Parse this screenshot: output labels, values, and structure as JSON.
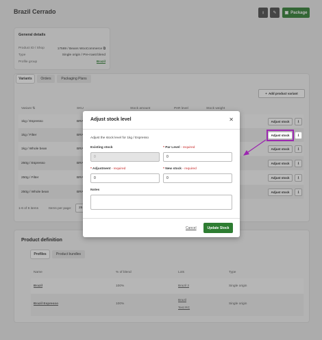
{
  "page": {
    "title": "Brazil Cerrado",
    "package_label": "Package"
  },
  "general": {
    "title": "General details",
    "rows": [
      {
        "label": "Product ID / Shop",
        "value": "17569 / Beans WooCommerce"
      },
      {
        "label": "Type",
        "value": "Single origin / Pre-roast blend"
      },
      {
        "label": "Profile group",
        "value": "Brazil"
      }
    ]
  },
  "tabs": [
    "Variants",
    "Orders",
    "Packaging Plans"
  ],
  "variants": {
    "add_label": "Add product variant",
    "headers": [
      "Variant",
      "SKU",
      "Stock amount",
      "PAR level",
      "Stock weight"
    ],
    "rows": [
      {
        "name": "1kg / Espresso",
        "sku": "BRA"
      },
      {
        "name": "1kg / Filter",
        "sku": "BRA"
      },
      {
        "name": "1kg / Whole bean",
        "sku": "BRA"
      },
      {
        "name": "250g / Espresso",
        "sku": "BRA"
      },
      {
        "name": "250g / Filter",
        "sku": "BRA"
      },
      {
        "name": "250g / Whole bean",
        "sku": "BRA"
      }
    ],
    "adjust_label": "Adjust stock",
    "footer_count": "1-6 of 6 items",
    "per_page_label": "Items per page:",
    "per_page_value": "25"
  },
  "definition": {
    "title": "Product definition",
    "tabs": [
      "Profiles",
      "Product bundles"
    ],
    "headers": [
      "Name",
      "% of blend",
      "Lots",
      "Type"
    ],
    "rows": [
      {
        "name": "Brazil",
        "blend": "100%",
        "lots": [
          "Brazil 2"
        ],
        "type": "Single origin"
      },
      {
        "name": "Brazil Espresso",
        "blend": "100%",
        "lots": [
          "Brazil",
          "Test RC"
        ],
        "type": "Single origin"
      }
    ]
  },
  "modal": {
    "title": "Adjust stock level",
    "description": "Adjust the stock level for 1kg / Espresso",
    "existing_label": "Existing stock",
    "existing_value": "0",
    "par_label": "Par Level",
    "par_req": "- required",
    "par_value": "0",
    "adjustment_label": "Adjustment",
    "adjustment_req": "- required",
    "adjustment_value": "0",
    "new_label": "New stock",
    "new_req": "- required",
    "new_value": "0",
    "notes_label": "Notes",
    "cancel_label": "Cancel",
    "update_label": "Update Stock"
  },
  "colors": {
    "accent": "#2e7d32",
    "highlight": "#9c27b0",
    "required": "#c62828"
  }
}
